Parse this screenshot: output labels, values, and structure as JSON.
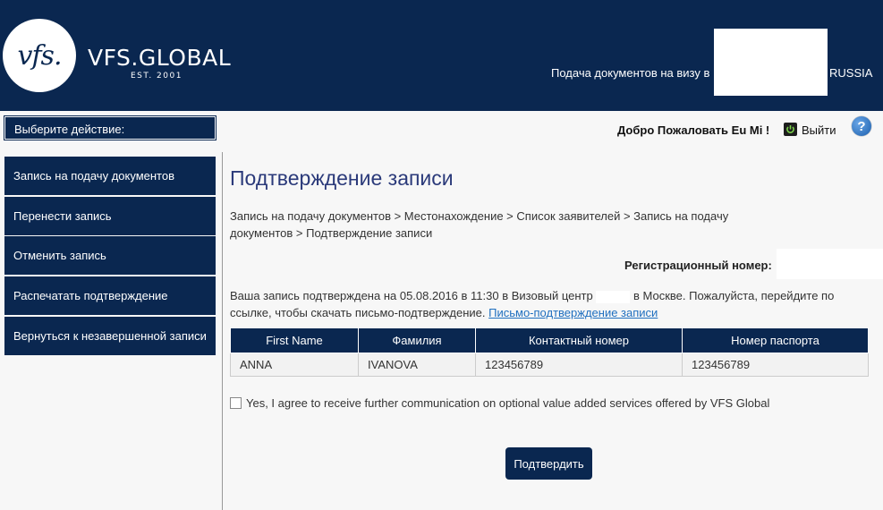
{
  "header": {
    "logo_text": "vfs.",
    "brand": "VFS.GLOBAL",
    "est": "EST. 2001",
    "submit_text": "Подача документов на визу в",
    "country": "RUSSIA"
  },
  "topbar": {
    "select_action": "Выберите действие:",
    "welcome": "Добро Пожаловать Eu Mi !",
    "logout": "Выйти",
    "help": "?"
  },
  "sidebar": {
    "items": [
      {
        "label": "Запись на подачу документов"
      },
      {
        "label": "Перенести запись"
      },
      {
        "label": "Отменить запись"
      },
      {
        "label": "Распечатать подтверждение"
      },
      {
        "label": "Вернуться к незавершенной записи"
      }
    ]
  },
  "main": {
    "title": "Подтверждение записи",
    "breadcrumb": "Запись на подачу документов  >  Местонахождение  >  Список заявителей  >  Запись на подачу документов  >  Подтверждение записи",
    "reg_label": "Регистрационный номер:",
    "msg_part1": "Ваша запись подтверждена на 05.08.2016 в 11:30 в Визовый центр",
    "msg_part2": "в Москве. Пожалуйста, перейдите по ссылке, чтобы скачать письмо-подтверждение.",
    "msg_link": "Письмо-подтверждение записи",
    "table": {
      "headers": [
        "First Name",
        "Фамилия",
        "Контактный номер",
        "Номер паспорта"
      ],
      "rows": [
        [
          "ANNA",
          "IVANOVA",
          "123456789",
          "123456789"
        ]
      ]
    },
    "agree_text": "Yes, I agree to receive further communication on optional value added services offered by VFS Global",
    "confirm_button": "Подтвердить"
  }
}
